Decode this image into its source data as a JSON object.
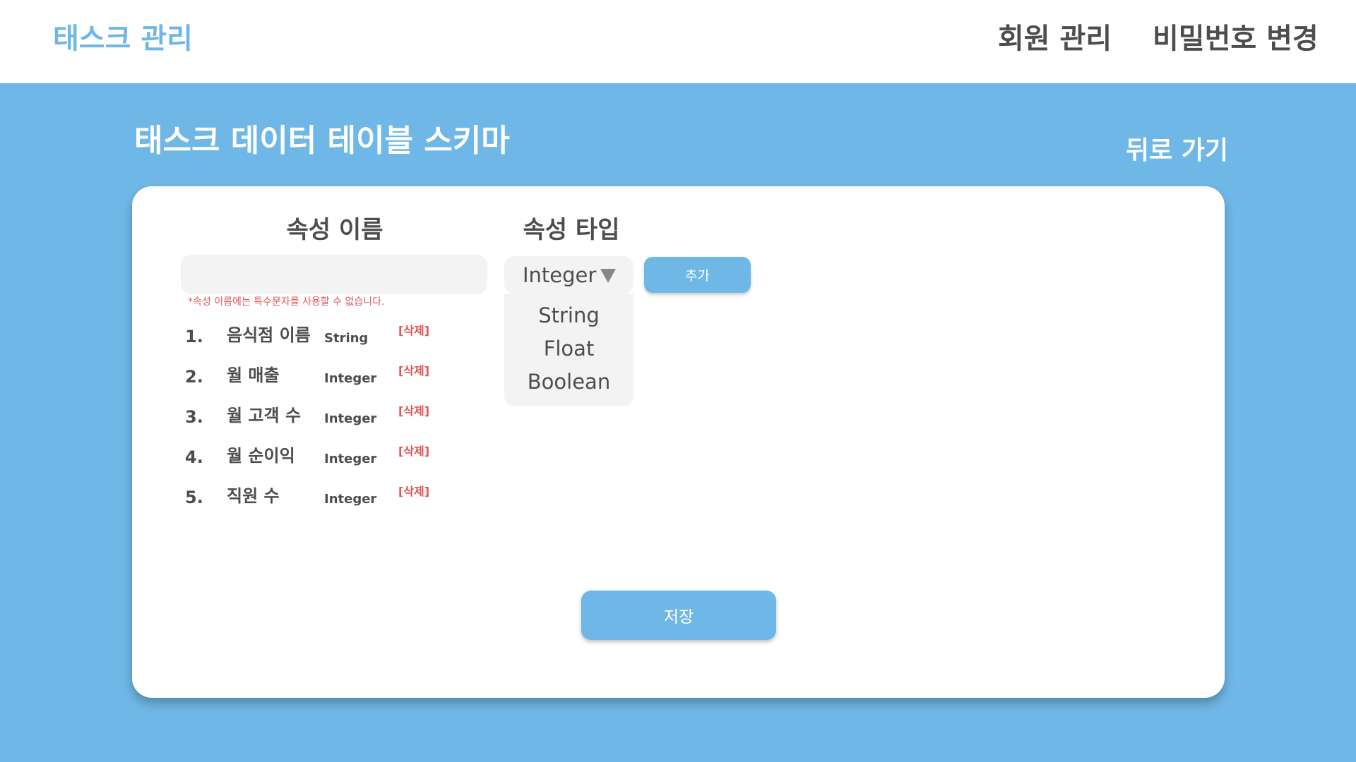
{
  "header": {
    "brand": "태스크 관리",
    "nav": [
      "회원 관리",
      "비밀번호 변경"
    ]
  },
  "page": {
    "title": "태스크 데이터 테이블 스키마",
    "back_label": "뒤로 가기"
  },
  "form": {
    "name_column_header": "속성 이름",
    "type_column_header": "속성 타입",
    "name_input_value": "",
    "hint": "*속성 이름에는 특수문자를 사용할 수 없습니다.",
    "selected_type": "Integer",
    "type_options": [
      "String",
      "Float",
      "Boolean"
    ],
    "add_label": "추가"
  },
  "attributes": [
    {
      "num": "1.",
      "name": "음식점 이름",
      "type": "String",
      "delete_label": "[삭제]"
    },
    {
      "num": "2.",
      "name": "월 매출",
      "type": "Integer",
      "delete_label": "[삭제]"
    },
    {
      "num": "3.",
      "name": "월 고객 수",
      "type": "Integer",
      "delete_label": "[삭제]"
    },
    {
      "num": "4.",
      "name": "월 순이익",
      "type": "Integer",
      "delete_label": "[삭제]"
    },
    {
      "num": "5.",
      "name": "직원 수",
      "type": "Integer",
      "delete_label": "[삭제]"
    }
  ],
  "save_label": "저장",
  "colors": {
    "accent": "#6fb7e6",
    "text": "#4d4d4d",
    "warning": "#e05555",
    "input_bg": "#f3f3f3"
  },
  "icons": {
    "dropdown": "caret-down-icon"
  }
}
